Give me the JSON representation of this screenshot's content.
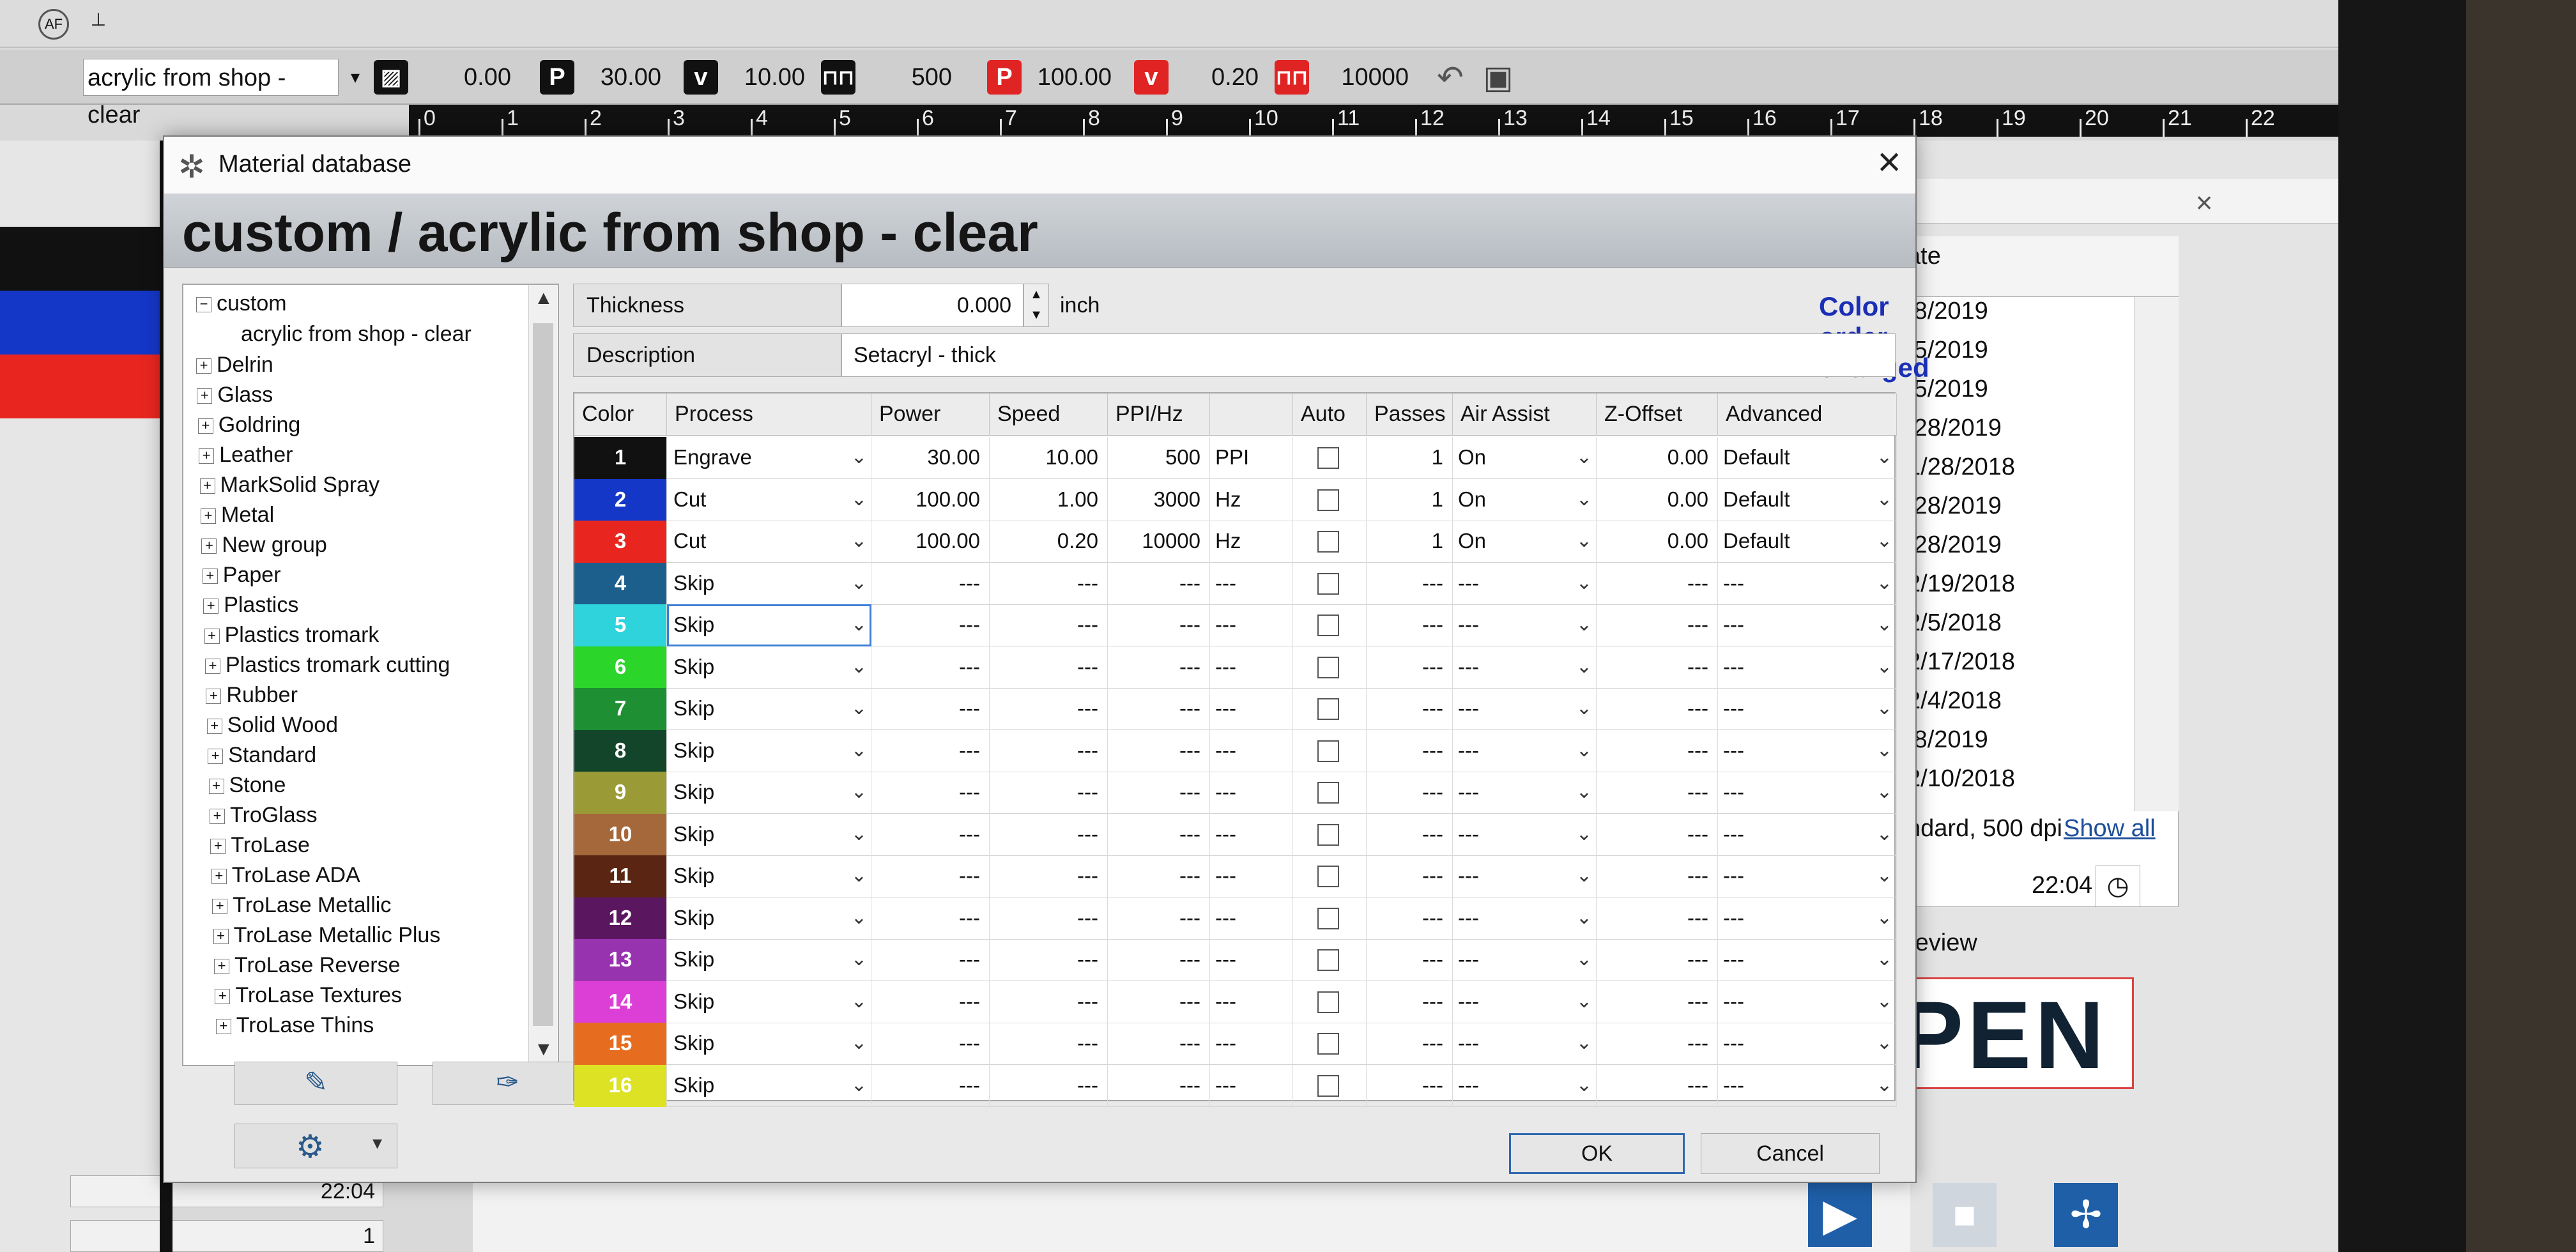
{
  "toolbar": {
    "material": "acrylic from shop - clear",
    "hatch_value": "0.00",
    "p1_label": "P",
    "p1_value": "30.00",
    "v1_label": "v",
    "v1_value": "10.00",
    "f1_value": "500",
    "p2_label": "P",
    "p2_value": "100.00",
    "v2_label": "v",
    "v2_value": "0.20",
    "f2_value": "10000"
  },
  "ruler": {
    "marks": [
      "0",
      "1",
      "2",
      "3",
      "4",
      "5",
      "6",
      "7",
      "8",
      "9",
      "10",
      "11",
      "12",
      "13",
      "14",
      "15",
      "16",
      "17",
      "18",
      "19",
      "20",
      "21",
      "22"
    ]
  },
  "dialog": {
    "title": "Material database",
    "close": "×",
    "heading": "custom / acrylic from shop - clear",
    "tree": {
      "root": "custom",
      "selected": "acrylic from shop - clear",
      "items": [
        "Delrin",
        "Glass",
        "Goldring",
        "Leather",
        "MarkSolid Spray",
        "Metal",
        "New group",
        "Paper",
        "Plastics",
        "Plastics tromark",
        "Plastics tromark cutting",
        "Rubber",
        "Solid Wood",
        "Standard",
        "Stone",
        "TroGlass",
        "TroLase",
        "TroLase ADA",
        "TroLase Metallic",
        "TroLase Metallic Plus",
        "TroLase Reverse",
        "TroLase Textures",
        "TroLase Thins"
      ]
    },
    "thickness": {
      "label": "Thickness",
      "value": "0.000",
      "unit": "inch"
    },
    "description": {
      "label": "Description",
      "value": "Setacryl - thick"
    },
    "alert": "Color order changed",
    "columns": [
      "Color",
      "Process",
      "Power",
      "Speed",
      "PPI/Hz",
      "",
      "Auto",
      "Passes",
      "Air Assist",
      "Z-Offset",
      "Advanced"
    ],
    "rows": [
      {
        "n": "1",
        "color": "#111111",
        "process": "Engrave",
        "power": "30.00",
        "speed": "10.00",
        "freq": "500",
        "unit": "PPI",
        "passes": "1",
        "air": "On",
        "z": "0.00",
        "adv": "Default"
      },
      {
        "n": "2",
        "color": "#1537c8",
        "process": "Cut",
        "power": "100.00",
        "speed": "1.00",
        "freq": "3000",
        "unit": "Hz",
        "passes": "1",
        "air": "On",
        "z": "0.00",
        "adv": "Default"
      },
      {
        "n": "3",
        "color": "#e8261f",
        "process": "Cut",
        "power": "100.00",
        "speed": "0.20",
        "freq": "10000",
        "unit": "Hz",
        "passes": "1",
        "air": "On",
        "z": "0.00",
        "adv": "Default"
      },
      {
        "n": "4",
        "color": "#1d5f8c",
        "process": "Skip",
        "power": "---",
        "speed": "---",
        "freq": "---",
        "unit": "---",
        "passes": "---",
        "air": "---",
        "z": "---",
        "adv": "---"
      },
      {
        "n": "5",
        "color": "#2ed3dc",
        "process": "Skip",
        "power": "---",
        "speed": "---",
        "freq": "---",
        "unit": "---",
        "passes": "---",
        "air": "---",
        "z": "---",
        "adv": "---"
      },
      {
        "n": "6",
        "color": "#2bd52a",
        "process": "Skip",
        "power": "---",
        "speed": "---",
        "freq": "---",
        "unit": "---",
        "passes": "---",
        "air": "---",
        "z": "---",
        "adv": "---"
      },
      {
        "n": "7",
        "color": "#1e8f32",
        "process": "Skip",
        "power": "---",
        "speed": "---",
        "freq": "---",
        "unit": "---",
        "passes": "---",
        "air": "---",
        "z": "---",
        "adv": "---"
      },
      {
        "n": "8",
        "color": "#12452a",
        "process": "Skip",
        "power": "---",
        "speed": "---",
        "freq": "---",
        "unit": "---",
        "passes": "---",
        "air": "---",
        "z": "---",
        "adv": "---"
      },
      {
        "n": "9",
        "color": "#9a9a37",
        "process": "Skip",
        "power": "---",
        "speed": "---",
        "freq": "---",
        "unit": "---",
        "passes": "---",
        "air": "---",
        "z": "---",
        "adv": "---"
      },
      {
        "n": "10",
        "color": "#a5683a",
        "process": "Skip",
        "power": "---",
        "speed": "---",
        "freq": "---",
        "unit": "---",
        "passes": "---",
        "air": "---",
        "z": "---",
        "adv": "---"
      },
      {
        "n": "11",
        "color": "#5a2613",
        "process": "Skip",
        "power": "---",
        "speed": "---",
        "freq": "---",
        "unit": "---",
        "passes": "---",
        "air": "---",
        "z": "---",
        "adv": "---"
      },
      {
        "n": "12",
        "color": "#5b1660",
        "process": "Skip",
        "power": "---",
        "speed": "---",
        "freq": "---",
        "unit": "---",
        "passes": "---",
        "air": "---",
        "z": "---",
        "adv": "---"
      },
      {
        "n": "13",
        "color": "#9833b0",
        "process": "Skip",
        "power": "---",
        "speed": "---",
        "freq": "---",
        "unit": "---",
        "passes": "---",
        "air": "---",
        "z": "---",
        "adv": "---"
      },
      {
        "n": "14",
        "color": "#dc3fd6",
        "process": "Skip",
        "power": "---",
        "speed": "---",
        "freq": "---",
        "unit": "---",
        "passes": "---",
        "air": "---",
        "z": "---",
        "adv": "---"
      },
      {
        "n": "15",
        "color": "#e66d1f",
        "process": "Skip",
        "power": "---",
        "speed": "---",
        "freq": "---",
        "unit": "---",
        "passes": "---",
        "air": "---",
        "z": "---",
        "adv": "---"
      },
      {
        "n": "16",
        "color": "#dde324",
        "process": "Skip",
        "power": "---",
        "speed": "---",
        "freq": "---",
        "unit": "---",
        "passes": "---",
        "air": "---",
        "z": "---",
        "adv": "---"
      }
    ],
    "ok": "OK",
    "cancel": "Cancel"
  },
  "background": {
    "date_header": "ate",
    "dates": [
      "/8/2019",
      "/5/2019",
      "/5/2019",
      "/28/2019",
      "1/28/2018",
      "/28/2019",
      "/28/2019",
      "2/19/2018",
      "2/5/2018",
      "2/17/2018",
      "2/4/2018",
      "/8/2019",
      "2/10/2018"
    ],
    "dpi_text": "ndard, 500 dpi",
    "show_all": "Show all",
    "time_right": "22:04",
    "preview": "review",
    "open_text": "PEN",
    "time_left": "22:04",
    "count_left": "1"
  }
}
